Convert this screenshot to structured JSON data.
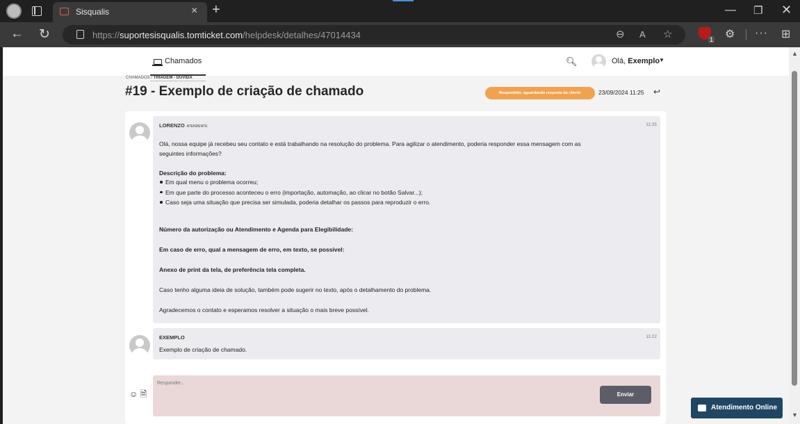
{
  "browser": {
    "tab_title": "Sisqualis",
    "tab_close": "×",
    "new_tab": "+",
    "url_prefix": "https://",
    "url_host": "suportesisqualis.tomticket.com",
    "url_path": "/helpdesk/detalhes/47014434",
    "more_menu": "···"
  },
  "header": {
    "tab_label": "Chamados",
    "greeting": "Olá,",
    "user_name": "Exemplo"
  },
  "breadcrumb": {
    "root": "CHAMADOS",
    "separator": " / ",
    "current": "TRIAGEM - DÚVIDA"
  },
  "ticket": {
    "title": "#19 - Exemplo de criação de chamado",
    "status": "Respondido, aguardando resposta do cliente",
    "datetime": "23/09/2024 11:25"
  },
  "messages": [
    {
      "author": "LORENZO",
      "role": "ATENDENTE",
      "time": "11:25",
      "intro_1": "Olá, nossa equipe já recebeu seu contato e está trabalhando na resolução do problema. Para agilizar o atendimento, poderia responder essa mensagem com as",
      "intro_2": "seguintes informações?",
      "heading": "Descrição do problema:",
      "bullets": [
        "Em qual menu o problema ocorreu;",
        "Em que parte do processo aconteceu o erro (importação, automação, ao clicar no botão Salvar...);",
        "Caso seja uma situação que precisa ser simulada, poderia detalhar os passos para reproduzir o erro."
      ],
      "q1": "Número da autorização ou Atendimento e Agenda para Elegibilidade:",
      "q2": "Em caso de erro, qual a mensagem de erro, em texto, se possível:",
      "q3": "Anexo de print da tela, de preferência tela completa.",
      "p1": "Caso tenho alguma ideia de solução, também pode sugerir no texto, após o detalhamento do problema.",
      "p2": "Agradecemos o contato e esperamos resolver a situação o mais breve possível."
    },
    {
      "author": "EXEMPLO",
      "time": "11:22",
      "text": "Exemplo de criação de chamado."
    }
  ],
  "composer": {
    "placeholder": "Responder...",
    "send_label": "Enviar"
  },
  "widget": {
    "label": "Atendimento Online"
  }
}
